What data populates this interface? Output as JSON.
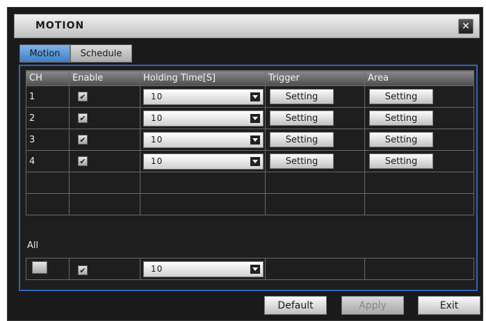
{
  "window": {
    "title": "MOTION",
    "close_icon": "close-icon"
  },
  "tabs": [
    {
      "label": "Motion",
      "active": true
    },
    {
      "label": "Schedule",
      "active": false
    }
  ],
  "table": {
    "headers": [
      "CH",
      "Enable",
      "Holding Time[S]",
      "Trigger",
      "Area"
    ],
    "rows": [
      {
        "ch": "1",
        "enabled": true,
        "holding_time": "10",
        "trigger": "Setting",
        "area": "Setting"
      },
      {
        "ch": "2",
        "enabled": true,
        "holding_time": "10",
        "trigger": "Setting",
        "area": "Setting"
      },
      {
        "ch": "3",
        "enabled": true,
        "holding_time": "10",
        "trigger": "Setting",
        "area": "Setting"
      },
      {
        "ch": "4",
        "enabled": true,
        "holding_time": "10",
        "trigger": "Setting",
        "area": "Setting"
      }
    ]
  },
  "all": {
    "label": "All",
    "checked_all": false,
    "enabled": true,
    "holding_time": "10"
  },
  "buttons": {
    "default": "Default",
    "apply": "Apply",
    "exit": "Exit"
  },
  "colors": {
    "accent": "#2f67b9",
    "tab_active": "#5b97d8",
    "background": "#1e1e1e"
  }
}
